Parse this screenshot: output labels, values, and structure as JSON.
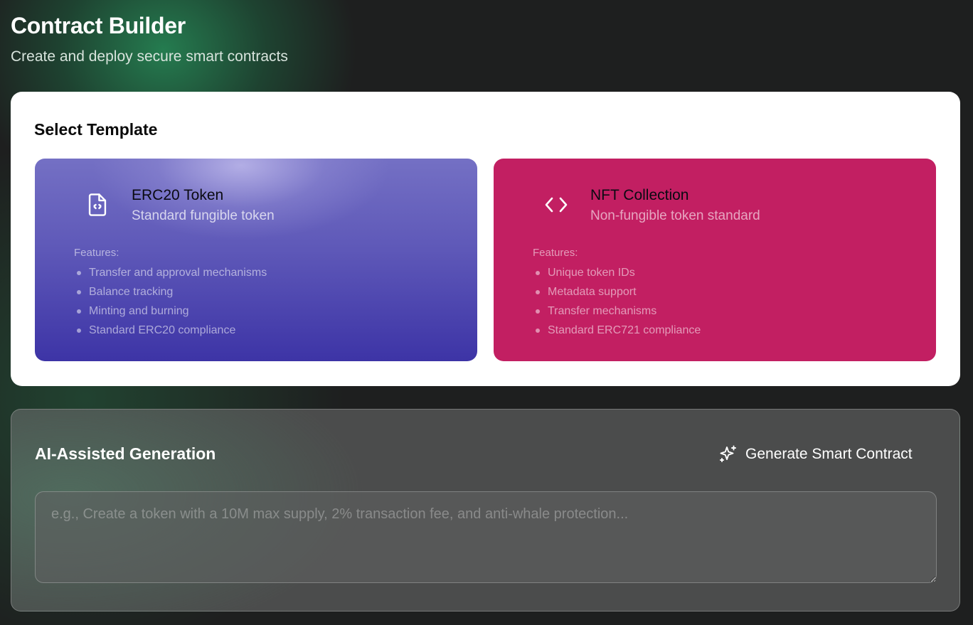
{
  "header": {
    "title": "Contract Builder",
    "subtitle": "Create and deploy secure smart contracts"
  },
  "templates": {
    "section_title": "Select Template",
    "items": [
      {
        "name": "ERC20 Token",
        "description": "Standard fungible token",
        "icon": "file-code-icon",
        "features_label": "Features:",
        "features": [
          "Transfer and approval mechanisms",
          "Balance tracking",
          "Minting and burning",
          "Standard ERC20 compliance"
        ],
        "color": "#5b55b8"
      },
      {
        "name": "NFT Collection",
        "description": "Non-fungible token standard",
        "icon": "code-brackets-icon",
        "features_label": "Features:",
        "features": [
          "Unique token IDs",
          "Metadata support",
          "Transfer mechanisms",
          "Standard ERC721 compliance"
        ],
        "color": "#c21f62"
      }
    ]
  },
  "ai": {
    "title": "AI-Assisted Generation",
    "generate_label": "Generate Smart Contract",
    "generate_icon": "sparkles-icon",
    "prompt_placeholder": "e.g., Create a token with a 10M max supply, 2% transaction fee, and anti-whale protection...",
    "prompt_value": ""
  }
}
